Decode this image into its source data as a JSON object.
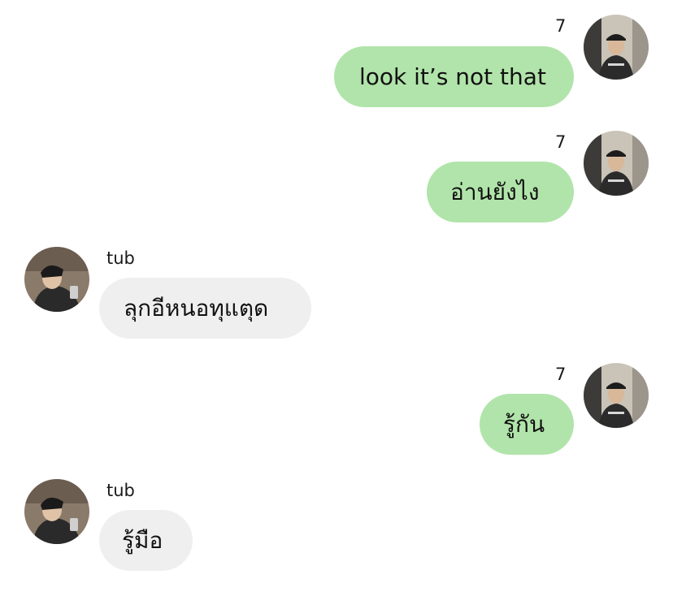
{
  "messages": [
    {
      "sender": "7",
      "text": "look it’s not that",
      "direction": "outgoing",
      "avatar": "user-7-avatar"
    },
    {
      "sender": "7",
      "text": "อ่านยังไง",
      "direction": "outgoing",
      "avatar": "user-7-avatar"
    },
    {
      "sender": "tub",
      "text": "ลุกอีหนอทุแตุด",
      "direction": "incoming",
      "avatar": "user-tub-avatar"
    },
    {
      "sender": "7",
      "text": "รู้กัน",
      "direction": "outgoing",
      "avatar": "user-7-avatar"
    },
    {
      "sender": "tub",
      "text": "รู้มือ",
      "direction": "incoming",
      "avatar": "user-tub-avatar"
    }
  ],
  "colors": {
    "outgoing_bubble": "#b1e4aa",
    "incoming_bubble": "#efefef",
    "background": "#ffffff",
    "text": "#111111"
  }
}
